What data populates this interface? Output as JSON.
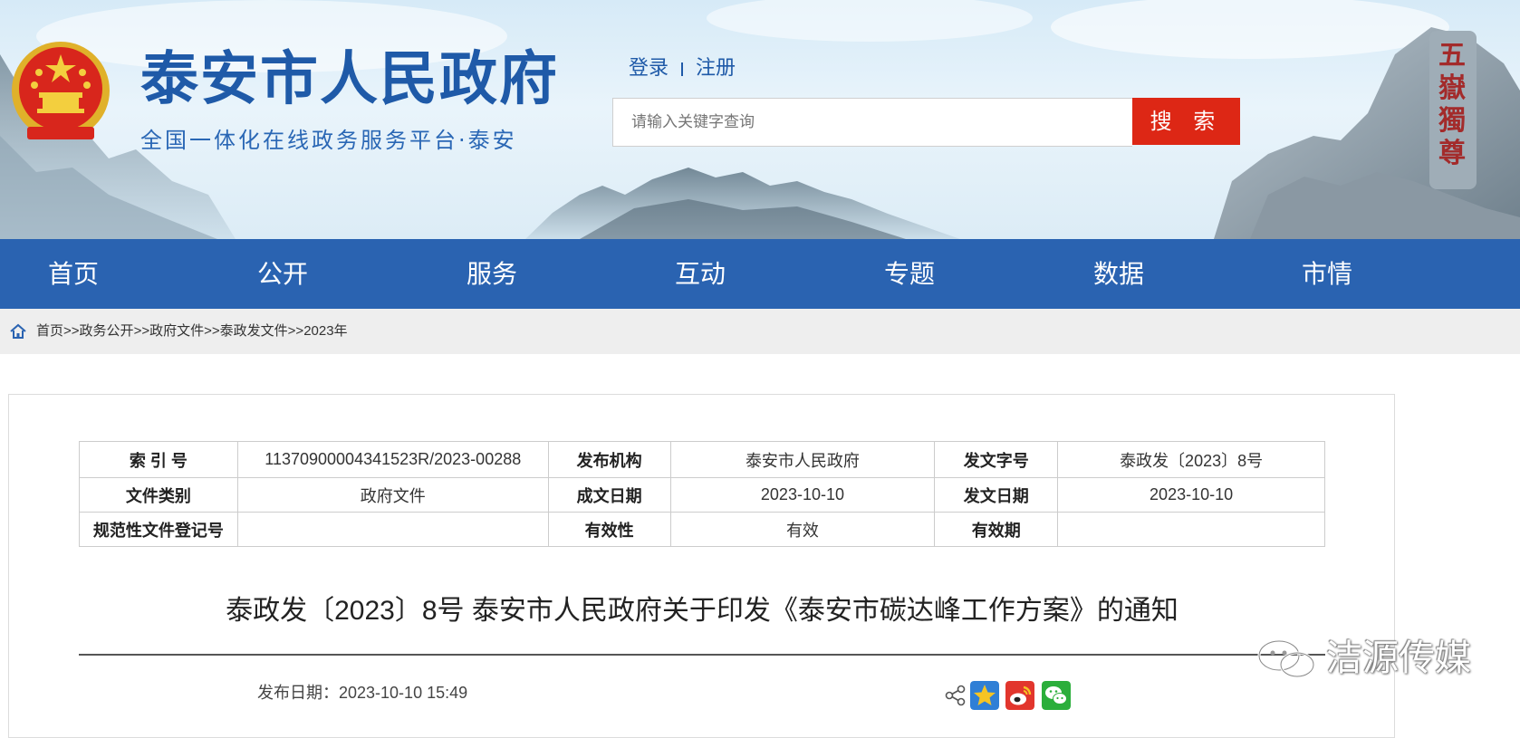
{
  "header": {
    "site_title": "泰安市人民政府",
    "site_subtitle": "全国一体化在线政务服务平台·泰安",
    "scenery_calligraphy": "五嶽獨尊",
    "login_label": "登录",
    "register_label": "注册",
    "search_placeholder": "请输入关键字查询",
    "search_button": "搜 索",
    "colors": {
      "brand_blue": "#1f5aa8",
      "search_red": "#dd2715"
    }
  },
  "nav": {
    "items": [
      {
        "label": "首页"
      },
      {
        "label": "公开"
      },
      {
        "label": "服务"
      },
      {
        "label": "互动"
      },
      {
        "label": "专题"
      },
      {
        "label": "数据"
      },
      {
        "label": "市情"
      }
    ],
    "background": "#2a63b1"
  },
  "breadcrumb": {
    "icon": "home-icon",
    "items": [
      "首页",
      "政务公开",
      "政府文件",
      "泰政发文件",
      "2023年"
    ],
    "separator": ">>"
  },
  "doc_meta": {
    "rows": [
      [
        {
          "label": "索 引 号",
          "value": "11370900004341523R/2023-00288"
        },
        {
          "label": "发布机构",
          "value": "泰安市人民政府"
        },
        {
          "label": "发文字号",
          "value": "泰政发〔2023〕8号"
        }
      ],
      [
        {
          "label": "文件类别",
          "value": "政府文件"
        },
        {
          "label": "成文日期",
          "value": "2023-10-10"
        },
        {
          "label": "发文日期",
          "value": "2023-10-10"
        }
      ],
      [
        {
          "label": "规范性文件登记号",
          "value": ""
        },
        {
          "label": "有效性",
          "value": "有效"
        },
        {
          "label": "有效期",
          "value": ""
        }
      ]
    ]
  },
  "document": {
    "title": "泰政发〔2023〕8号 泰安市人民政府关于印发《泰安市碳达峰工作方案》的通知",
    "publish_label": "发布日期：",
    "publish_datetime": "2023-10-10 15:49"
  },
  "share": {
    "icons": [
      "share-icon",
      "qzone-icon",
      "weibo-icon",
      "wechat-icon"
    ]
  },
  "watermark": {
    "text": "洁源传媒",
    "icon": "wechat-watermark-icon"
  }
}
